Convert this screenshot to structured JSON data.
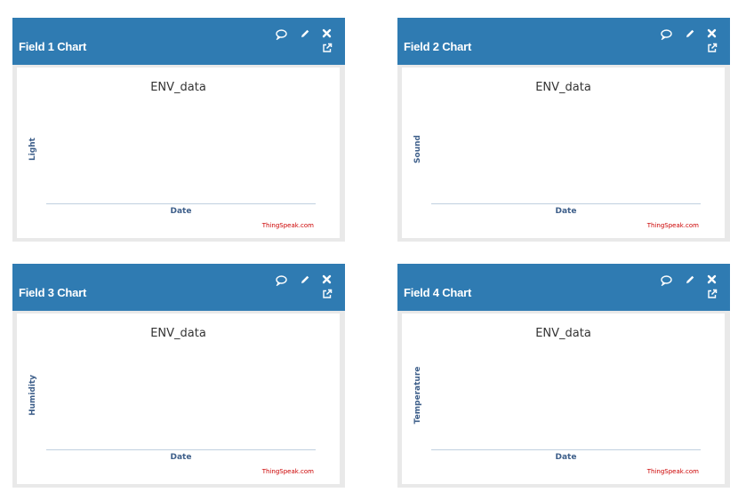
{
  "colors": {
    "header_bg": "#2f7bb2",
    "header_text": "#ffffff",
    "axis_label": "#3e5f8a",
    "credit": "#cc0000",
    "frame_bg": "#e9e9e9"
  },
  "icons": [
    "comment-icon",
    "pencil-icon",
    "close-icon",
    "external-link-icon"
  ],
  "panels": [
    {
      "title": "Field 1 Chart",
      "chart_title": "ENV_data",
      "ylabel": "Light",
      "xlabel": "Date",
      "credit": "ThingSpeak.com"
    },
    {
      "title": "Field 2 Chart",
      "chart_title": "ENV_data",
      "ylabel": "Sound",
      "xlabel": "Date",
      "credit": "ThingSpeak.com"
    },
    {
      "title": "Field 3 Chart",
      "chart_title": "ENV_data",
      "ylabel": "Humidity",
      "xlabel": "Date",
      "credit": "ThingSpeak.com"
    },
    {
      "title": "Field 4 Chart",
      "chart_title": "ENV_data",
      "ylabel": "Temperature",
      "xlabel": "Date",
      "credit": "ThingSpeak.com"
    }
  ]
}
